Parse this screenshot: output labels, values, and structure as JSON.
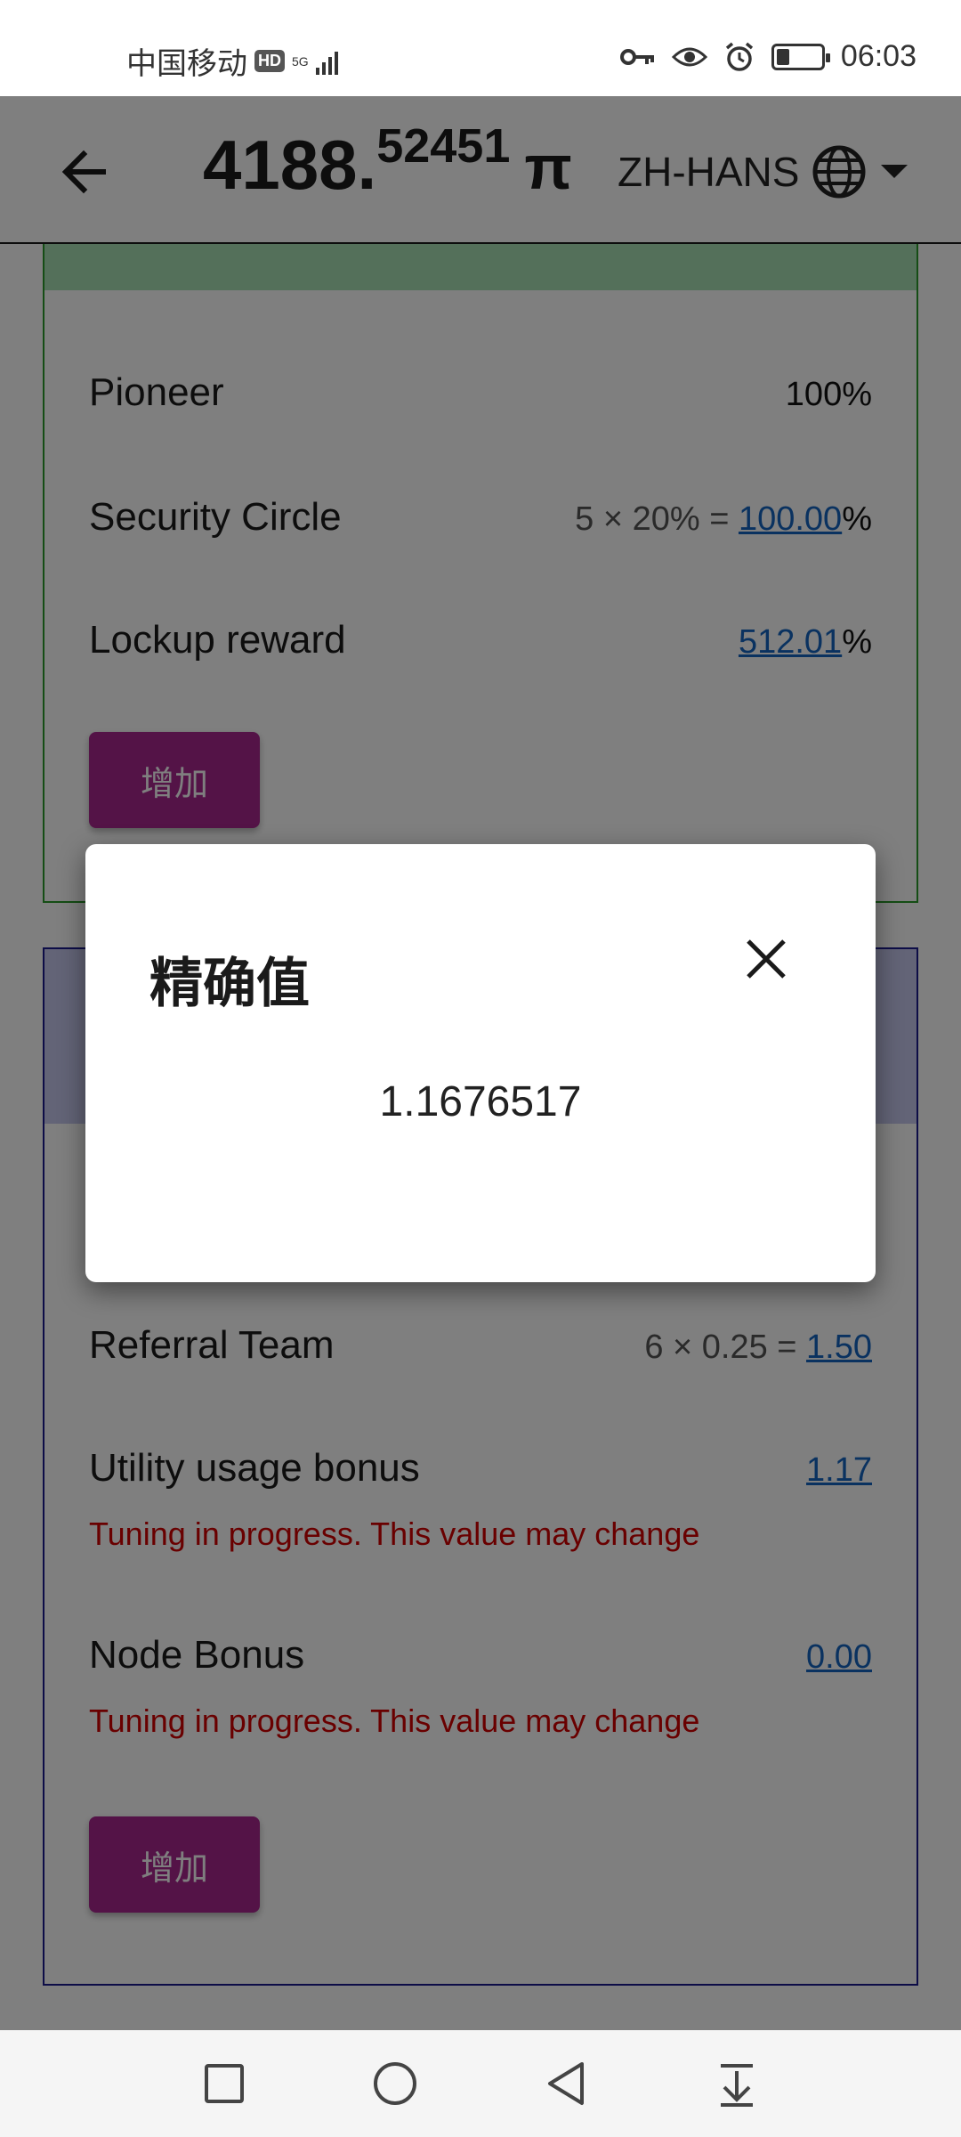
{
  "status_bar": {
    "carrier": "中国移动",
    "hd": "HD",
    "network": "5G",
    "time": "06:03"
  },
  "header": {
    "balance_int": "4188.",
    "balance_dec": "52451",
    "currency": "π",
    "language": "ZH-HANS"
  },
  "card1": {
    "rows": [
      {
        "label": "Pioneer",
        "value": "100%"
      },
      {
        "label": "Security Circle",
        "calc": "5 × 20% = ",
        "link": "100.00",
        "suffix": "%"
      },
      {
        "label": "Lockup reward",
        "link": "512.01",
        "suffix": "%"
      }
    ],
    "button": "增加"
  },
  "card2": {
    "rows": [
      {
        "label": "Referral Team",
        "calc": "6 × 0.25 = ",
        "link": "1.50"
      },
      {
        "label": "Utility usage bonus",
        "link": "1.17",
        "warning": "Tuning in progress. This value may change"
      },
      {
        "label": "Node Bonus",
        "link": "0.00",
        "warning": "Tuning in progress. This value may change"
      }
    ],
    "button": "增加"
  },
  "dialog": {
    "title": "精确值",
    "value": "1.1676517"
  },
  "colors": {
    "accent_button": "#a8278f",
    "link": "#1565c0",
    "warning": "#d30000",
    "green_border": "#2a9a2a",
    "blue_border": "#1a1a8e"
  }
}
